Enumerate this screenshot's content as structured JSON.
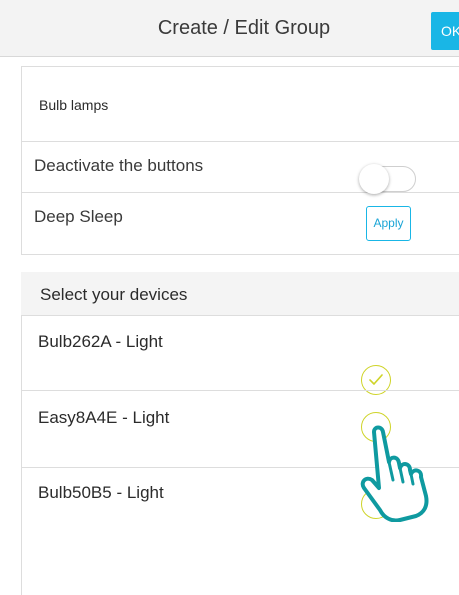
{
  "header": {
    "title": "Create / Edit Group",
    "ok_label": "OK"
  },
  "group": {
    "name_value": "Bulb lamps",
    "deactivate_label": "Deactivate the buttons",
    "deactivate_enabled": false,
    "deep_sleep_label": "Deep Sleep",
    "apply_label": "Apply"
  },
  "devices": {
    "header_label": "Select your devices",
    "items": [
      {
        "label": "Bulb262A - Light",
        "selected": true
      },
      {
        "label": "Easy8A4E - Light",
        "selected": false
      },
      {
        "label": "Bulb50B5 - Light",
        "selected": false
      }
    ]
  },
  "colors": {
    "accent": "#19b6e6",
    "check": "#cfd42a",
    "pointer_hand": "#0f9aa0"
  },
  "icons": {
    "selected_check": "check-circle-icon",
    "unselected_check": "empty-circle-icon",
    "pointer": "pointing-hand-icon"
  }
}
